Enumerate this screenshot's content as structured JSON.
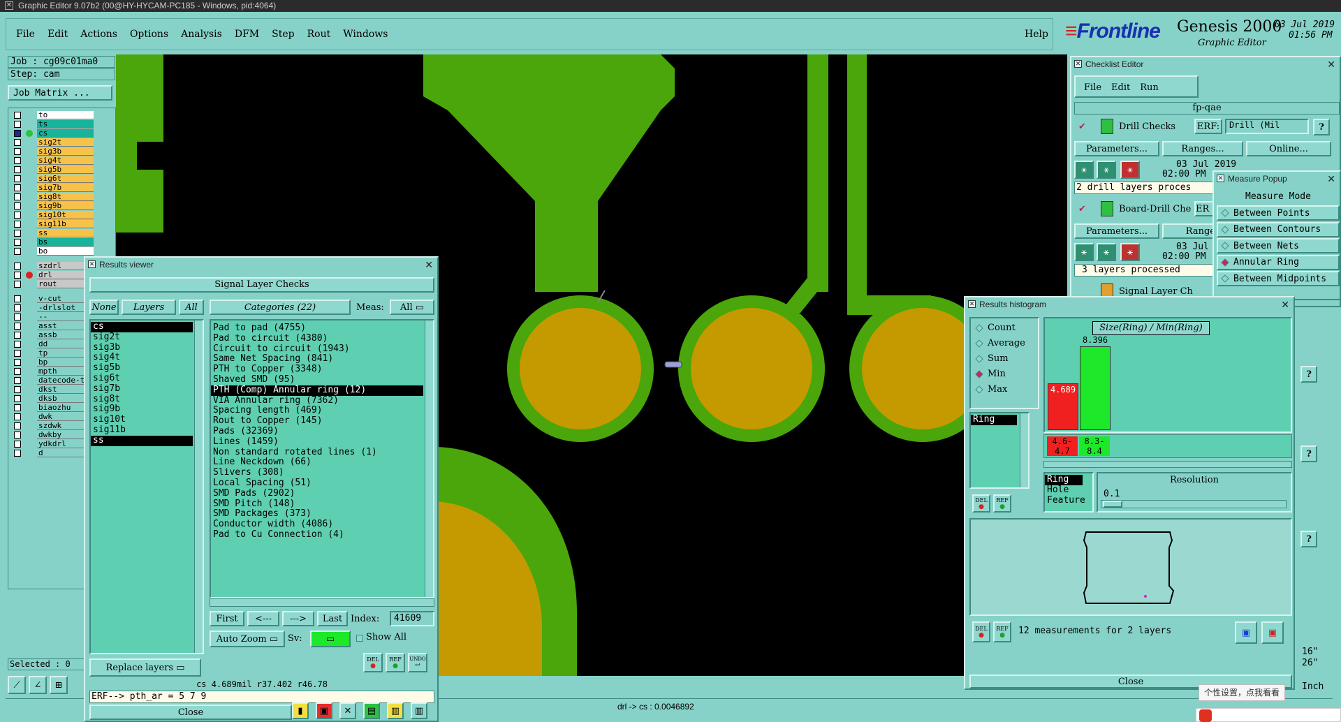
{
  "window_title": "Graphic Editor 9.07b2 (00@HY-HYCAM-PC185 - Windows, pid:4064)",
  "menu": [
    "File",
    "Edit",
    "Actions",
    "Options",
    "Analysis",
    "DFM",
    "Step",
    "Rout",
    "Windows"
  ],
  "help": "Help",
  "brand": {
    "name": "Frontline",
    "product": "Genesis 2000",
    "sub": "Graphic Editor",
    "date": "03 Jul 2019",
    "time": "01:56 PM"
  },
  "job": {
    "job": "Job : cg09c01ma0",
    "step": "Step: cam",
    "matrix": "Job Matrix ..."
  },
  "layers": [
    {
      "name": "to",
      "color": "#ffffff"
    },
    {
      "name": "ts",
      "color": "#17b39a"
    },
    {
      "name": "cs",
      "color": "#17b39a"
    },
    {
      "name": "sig2t",
      "color": "#f7c24a"
    },
    {
      "name": "sig3b",
      "color": "#f7c24a"
    },
    {
      "name": "sig4t",
      "color": "#f7c24a"
    },
    {
      "name": "sig5b",
      "color": "#f7c24a"
    },
    {
      "name": "sig6t",
      "color": "#f7c24a"
    },
    {
      "name": "sig7b",
      "color": "#f7c24a"
    },
    {
      "name": "sig8t",
      "color": "#f7c24a"
    },
    {
      "name": "sig9b",
      "color": "#f7c24a"
    },
    {
      "name": "sig10t",
      "color": "#f7c24a"
    },
    {
      "name": "sig11b",
      "color": "#f7c24a"
    },
    {
      "name": "ss",
      "color": "#f7c24a"
    },
    {
      "name": "bs",
      "color": "#17b39a"
    },
    {
      "name": "bo",
      "color": "#ffffff"
    }
  ],
  "drill_layers": [
    {
      "name": "szdrl",
      "color": "#c8c8c8"
    },
    {
      "name": "drl",
      "color": "#c8c8c8"
    },
    {
      "name": "rout",
      "color": "#c8c8c8"
    }
  ],
  "misc_layers": [
    "v-cut",
    "-drlslot",
    "--",
    "asst",
    "assb",
    "dd",
    "tp",
    "bp",
    "mpth",
    "datecode-t",
    "dkst",
    "dksb",
    "biaozhu",
    "dwk",
    "szdwk",
    "dwkby",
    "ydkdrl",
    "d"
  ],
  "selected": "Selected : 0",
  "results_viewer": {
    "title": "Results viewer",
    "header": "Signal Layer Checks",
    "none": "None",
    "layers_label": "Layers",
    "all": "All",
    "categories_label": "Categories (22)",
    "meas_label": "Meas:",
    "meas_value": "All",
    "layers": [
      "cs",
      "sig2t",
      "sig3b",
      "sig4t",
      "sig5b",
      "sig6t",
      "sig7b",
      "sig8t",
      "sig9b",
      "sig10t",
      "sig11b",
      "ss"
    ],
    "categories": [
      "Pad to pad (4755)",
      "Pad to circuit (4380)",
      "Circuit to circuit (1943)",
      "Same Net Spacing (841)",
      "PTH to Copper (3348)",
      "Shaved SMD (95)",
      "PTH (Comp) Annular ring (12)",
      "VIA Annular ring (7362)",
      "Spacing length (469)",
      "Rout to Copper (145)",
      "Pads (32369)",
      "Lines (1459)",
      "Non standard rotated lines (1)",
      "Line Neckdown (66)",
      "Slivers (308)",
      "Local Spacing (51)",
      "SMD Pads (2902)",
      "SMD Pitch (148)",
      "SMD Packages (373)",
      "Conductor width (4086)",
      "Pad to Cu Connection (4)"
    ],
    "first": "First",
    "prev": "<---",
    "next": "--->",
    "last": "Last",
    "index_label": "Index:",
    "index_value": "41609",
    "auto_zoom": "Auto Zoom",
    "sv": "Sv:",
    "show_all": "Show All",
    "replace": "Replace layers",
    "status": "cs 4.689mil   r37.402   r46.78",
    "erf": "ERF--> pth_ar = 5 7 9",
    "close": "Close",
    "del": "DEL",
    "ref": "REF",
    "undo": "UNDO"
  },
  "checklist": {
    "title": "Checklist Editor",
    "menu": [
      "File",
      "Edit",
      "Run"
    ],
    "name": "fp-qae",
    "drill_checks": "Drill Checks",
    "erf_label": "ERF:",
    "erf_value": "Drill (Mil",
    "parameters": "Parameters...",
    "ranges": "Ranges...",
    "online": "Online...",
    "date": "03 Jul 2019",
    "time": "02:00 PM",
    "drill_status": "2 drill layers proces",
    "board_drill": "Board-Drill Che",
    "er": "ER",
    "ranges2": "Range",
    "date2": "03 Jul",
    "time2": "02:00 PM",
    "layers_processed": "3 layers processed",
    "signal_layer": "Signal Layer Ch",
    "q": "?"
  },
  "measure_popup": {
    "title": "Measure Popup",
    "header": "Measure Mode",
    "items": [
      "Between Points",
      "Between Contours",
      "Between Nets",
      "Annular Ring",
      "Between Midpoints"
    ]
  },
  "histogram": {
    "title": "Results histogram",
    "modes": [
      "Count",
      "Average",
      "Sum",
      "Min",
      "Max"
    ],
    "active_mode": "Min",
    "param_list": [
      "Ring"
    ],
    "size_label": "Size(Ring) / Min(Ring)",
    "bars": [
      {
        "value": 4.689,
        "label": "4.689",
        "range": "4.6-4.7",
        "color": "#f02020"
      },
      {
        "value": 8.396,
        "label": "8.396",
        "range": "8.3-8.4",
        "color": "#1ee82a"
      }
    ],
    "sources": [
      "Ring",
      "Hole",
      "Feature"
    ],
    "resolution_label": "Resolution",
    "resolution_value": "0.1",
    "measurements": "12 measurements for 2 layers",
    "close": "Close",
    "del": "DEL",
    "ref": "REF"
  },
  "bottom_status": "drl -> cs : 0.0046892",
  "right_fragments": {
    "a": "16\"",
    "b": "26\"",
    "c": "Inch"
  },
  "tooltip": "个性设置，点我看看",
  "colors": {
    "copper": "#4aa60a",
    "pad": "#c49a00",
    "canvas": "#000000",
    "panel": "#86d2c8",
    "list": "#5fcfb2"
  }
}
